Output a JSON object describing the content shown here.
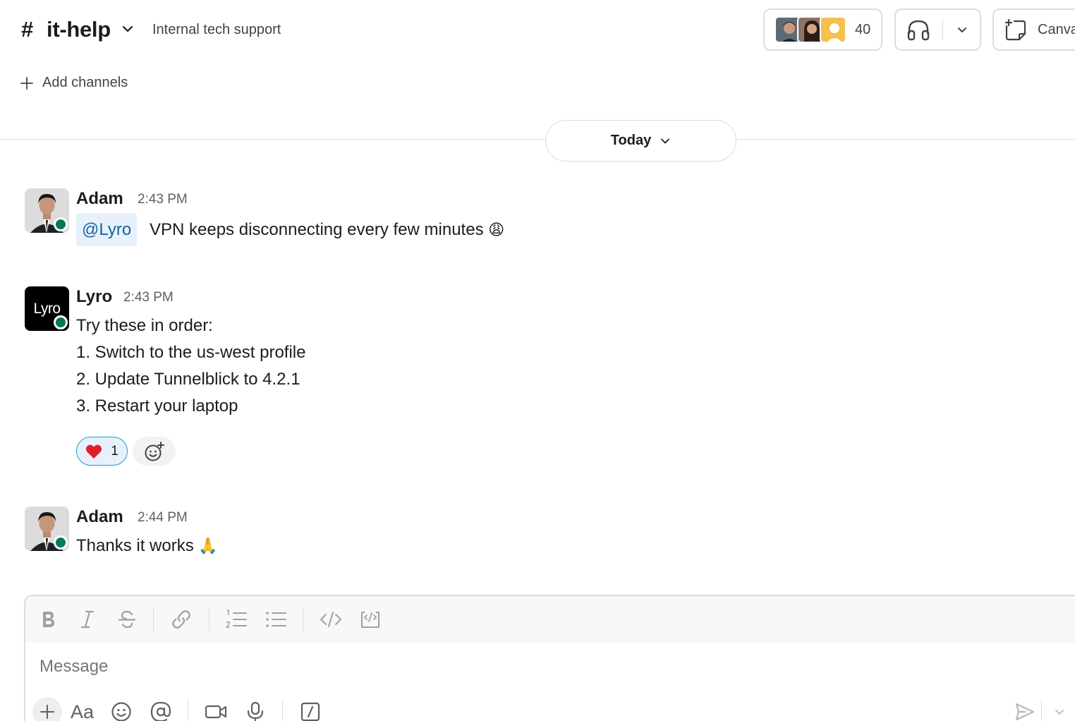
{
  "header": {
    "hash": "#",
    "channel_name": "it-help",
    "description": "Internal tech support",
    "member_count": "40",
    "canvas_label": "Canva",
    "add_channels": "Add channels"
  },
  "divider": {
    "label": "Today"
  },
  "messages": [
    {
      "author": "Adam",
      "time": "2:43 PM",
      "mention": "@Lyro",
      "text": "VPN keeps disconnecting every few minutes",
      "emoji": "😩"
    },
    {
      "author": "Lyro",
      "time": "2:43 PM",
      "avatar_text": "Lyro",
      "lines": [
        "Try these in order:",
        "1. Switch to the us-west profile",
        "2. Update Tunnelblick to 4.2.1",
        "3. Restart your laptop"
      ],
      "reaction": {
        "emoji": "❤️",
        "count": "1"
      }
    },
    {
      "author": "Adam",
      "time": "2:44 PM",
      "text": "Thanks it works",
      "emoji": "🙏"
    }
  ],
  "composer": {
    "placeholder": "Message",
    "aa_label": "Aa"
  },
  "colors": {
    "accent": "#1264a3",
    "presence": "#007a5a",
    "mention_bg": "#e8f1fb",
    "reaction_border": "#1d9bd1"
  },
  "icons": [
    "chevron-down-icon",
    "headphones-icon",
    "canvas-icon",
    "plus-icon",
    "heart-icon",
    "add-reaction-icon",
    "bold-icon",
    "italic-icon",
    "strikethrough-icon",
    "link-icon",
    "ordered-list-icon",
    "bulleted-list-icon",
    "code-icon",
    "code-block-icon",
    "emoji-icon",
    "at-icon",
    "video-icon",
    "microphone-icon",
    "slash-command-icon",
    "send-icon"
  ]
}
